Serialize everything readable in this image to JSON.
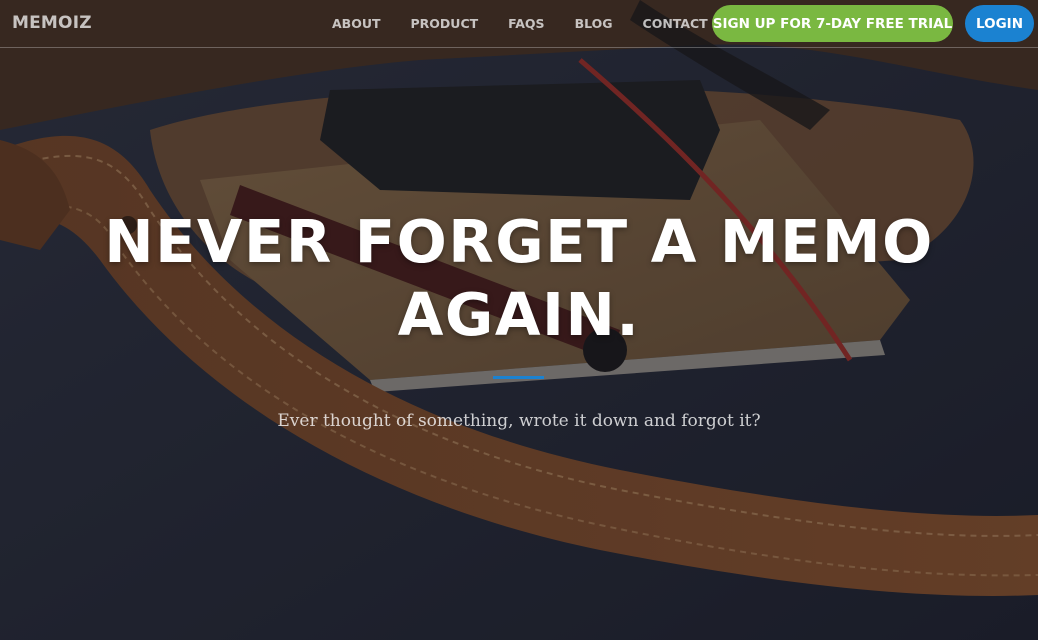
{
  "brand": {
    "name": "MEMOIZ"
  },
  "nav": {
    "links": [
      {
        "label": "ABOUT"
      },
      {
        "label": "PRODUCT"
      },
      {
        "label": "FAQS"
      },
      {
        "label": "BLOG"
      },
      {
        "label": "CONTACT"
      }
    ],
    "trial_button_label": "SIGN UP FOR 7-DAY FREE TRIAL",
    "login_button_label": "LOGIN"
  },
  "hero": {
    "title": "NEVER FORGET A MEMO AGAIN.",
    "subtitle": "Ever thought of something, wrote it down and forgot it?"
  },
  "colors": {
    "accent_blue": "#1b82d1",
    "accent_green": "#7ab841",
    "text_white": "#ffffff"
  }
}
